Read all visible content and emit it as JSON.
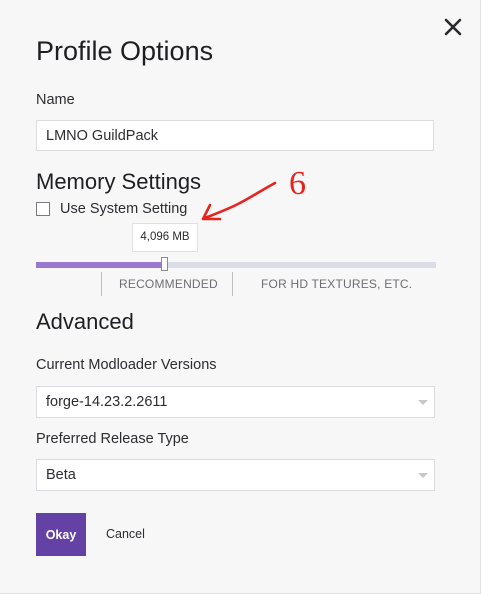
{
  "dialog": {
    "title": "Profile Options",
    "close_icon": "close-icon"
  },
  "name_field": {
    "label": "Name",
    "value": "LMNO GuildPack"
  },
  "memory": {
    "heading": "Memory Settings",
    "use_system_setting_label": "Use System Setting",
    "use_system_setting_checked": false,
    "value_label": "4,096 MB",
    "slider_fraction": 0.32,
    "marks": [
      "RECOMMENDED",
      "FOR HD TEXTURES, ETC."
    ],
    "track_color": "#dcdce6",
    "fill_color": "#9a78cf"
  },
  "annotation": {
    "text": "6",
    "color": "#e8231e"
  },
  "advanced": {
    "heading": "Advanced",
    "modloader_label": "Current Modloader Versions",
    "modloader_value": "forge-14.23.2.2611",
    "release_type_label": "Preferred Release Type",
    "release_type_value": "Beta"
  },
  "actions": {
    "okay_label": "Okay",
    "cancel_label": "Cancel",
    "primary_color": "#6441a4"
  }
}
